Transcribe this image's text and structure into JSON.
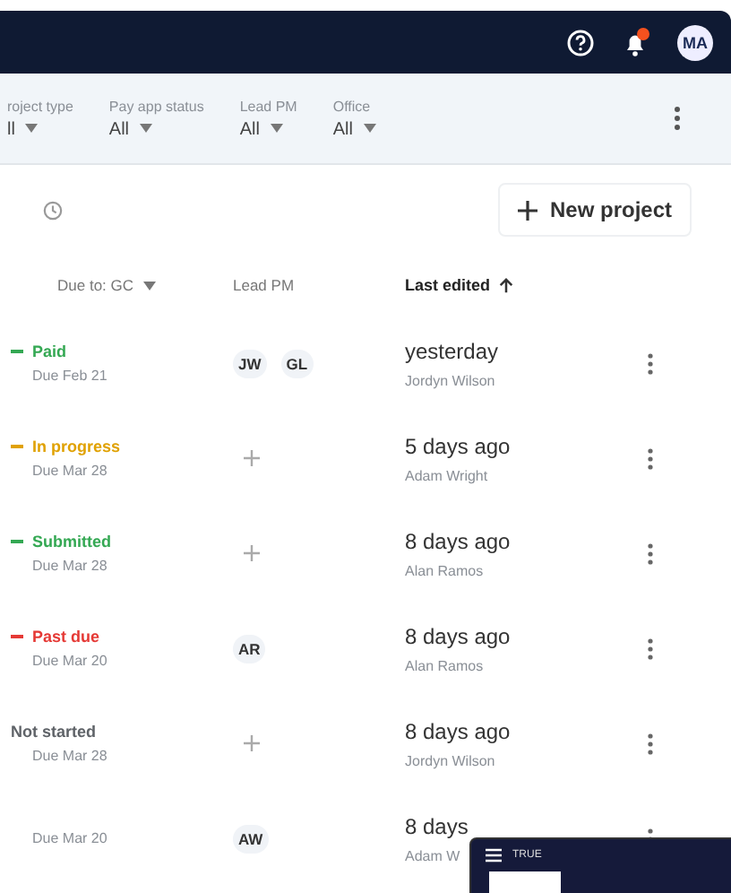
{
  "header": {
    "avatar": "MA",
    "notification_dot": true
  },
  "filters": [
    {
      "label": "roject type",
      "value": "ll"
    },
    {
      "label": "Pay app status",
      "value": "All"
    },
    {
      "label": "Lead PM",
      "value": "All"
    },
    {
      "label": "Office",
      "value": "All"
    }
  ],
  "toolbar": {
    "new_button": "New project"
  },
  "columns": {
    "due": "Due to: GC",
    "lead": "Lead PM",
    "edited": "Last edited"
  },
  "rows": [
    {
      "status": "Paid",
      "color": "#34a853",
      "marker": true,
      "due": "Due Feb 21",
      "leads": [
        "JW",
        "GL"
      ],
      "edited": "yesterday",
      "editor": "Jordyn Wilson"
    },
    {
      "status": "In progress",
      "color": "#e0a100",
      "marker": true,
      "due": "Due Mar 28",
      "leads": [],
      "edited": "5 days ago",
      "editor": "Adam Wright"
    },
    {
      "status": "Submitted",
      "color": "#34a853",
      "marker": true,
      "due": "Due Mar 28",
      "leads": [],
      "edited": "8 days ago",
      "editor": "Alan Ramos"
    },
    {
      "status": "Past due",
      "color": "#e53935",
      "marker": true,
      "due": "Due Mar 20",
      "leads": [
        "AR"
      ],
      "edited": "8 days ago",
      "editor": "Alan Ramos"
    },
    {
      "status": "Not started",
      "color": "#5f6368",
      "marker": false,
      "due": "Due Mar 28",
      "leads": [],
      "edited": "8 days ago",
      "editor": "Jordyn Wilson"
    },
    {
      "due": "Due Mar 20",
      "leads": [
        "AW"
      ],
      "edited": "8 days",
      "editor": "Adam W"
    }
  ],
  "overlay_window": {
    "title": "TRUE"
  }
}
